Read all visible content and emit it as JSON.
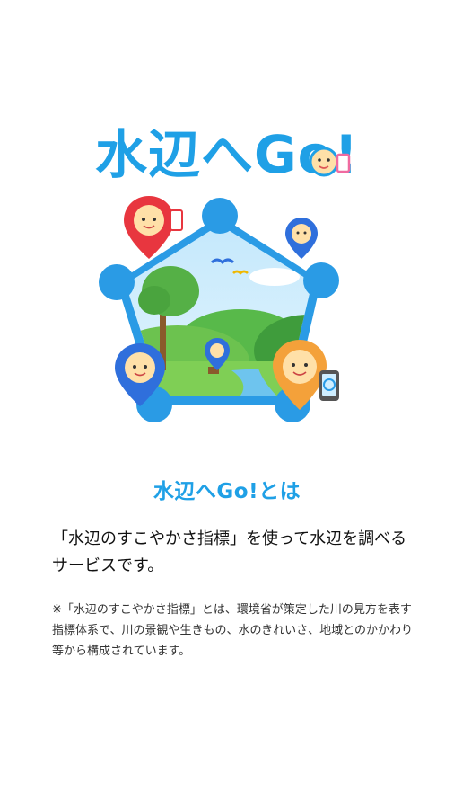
{
  "app": {
    "logo_text": "水辺へGo!"
  },
  "about": {
    "title": "水辺へGo!とは",
    "lead": "「水辺のすこやかさ指標」を使って水辺を調べるサービスです。",
    "note": "※「水辺のすこやかさ指標」とは、環境省が策定した川の見方を表す指標体系で、川の景観や生きもの、水のきれいさ、地域とのかかわり等から構成されています。"
  },
  "colors": {
    "brand_blue": "#1fa0e6",
    "pin_red": "#e8363f",
    "pin_orange": "#f4a13a",
    "pin_blue": "#2f6fdc"
  },
  "icons": [
    "map-pin-icon",
    "smartphone-icon",
    "bird-icon"
  ]
}
